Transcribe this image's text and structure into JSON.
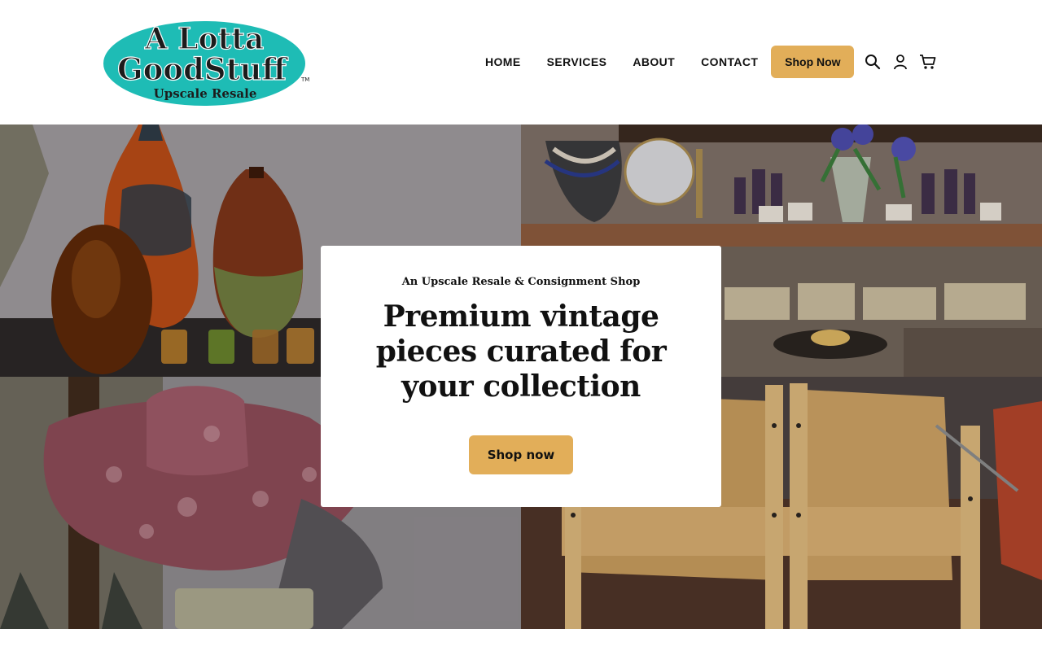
{
  "brand": {
    "logo_line1": "A Lotta",
    "logo_line2": "GoodStuff",
    "logo_tagline": "Upscale Resale",
    "logo_mark": "TM",
    "logo_colors": {
      "oval": "#1ebcb5",
      "text": "#1c1c1c"
    }
  },
  "nav": {
    "items": [
      {
        "label": "HOME"
      },
      {
        "label": "SERVICES"
      },
      {
        "label": "ABOUT"
      },
      {
        "label": "CONTACT"
      }
    ],
    "shop_button": "Shop Now",
    "icons": [
      "search-icon",
      "account-icon",
      "cart-icon"
    ]
  },
  "hero": {
    "kicker": "An Upscale Resale & Consignment Shop",
    "title": "Premium vintage pieces curated for your collection",
    "cta": "Shop now",
    "tiles": [
      "vases-photo",
      "jewelry-cosmetics-photo",
      "lace-hat-photo",
      "leather-chairs-photo"
    ]
  },
  "colors": {
    "accent": "#e2ae59",
    "text": "#111111",
    "background": "#ffffff"
  }
}
